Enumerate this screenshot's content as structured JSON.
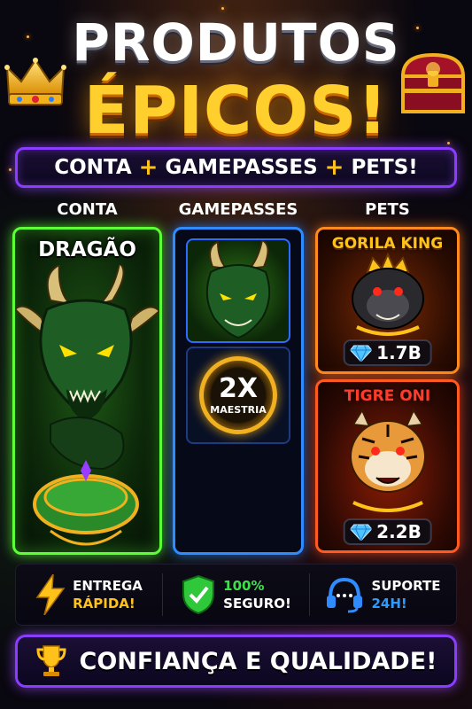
{
  "header": {
    "title_line1": "PRODUTOS",
    "title_line2": "ÉPICOS!"
  },
  "banner": {
    "item1": "CONTA",
    "plus1": "+",
    "item2": "GAMEPASSES",
    "plus2": "+",
    "item3": "PETS!"
  },
  "columns": {
    "conta_label": "CONTA",
    "gamepasses_label": "GAMEPASSES",
    "pets_label": "PETS"
  },
  "conta_panel": {
    "label": "DRAGÃO"
  },
  "gamepasses_panel": {
    "multiplier": "2X",
    "multiplier_text": "MAESTRIA"
  },
  "pets": [
    {
      "name": "GORILA KING",
      "price": "1.7B"
    },
    {
      "name": "TIGRE ONI",
      "price": "2.2B"
    }
  ],
  "features": [
    {
      "line1": "ENTREGA",
      "line2": "RÁPIDA!",
      "icon": "lightning-icon",
      "accent": "#ffc21a"
    },
    {
      "line1": "100%",
      "line2": "SEGURO!",
      "icon": "shield-check-icon",
      "accent": "#3ee04a"
    },
    {
      "line1": "SUPORTE",
      "line2": "24H!",
      "icon": "headset-icon",
      "accent": "#2e8cff"
    }
  ],
  "footer": {
    "text": "CONFIANÇA E QUALIDADE!"
  },
  "colors": {
    "gold": "#ffc21a",
    "purple_border": "#8b3dff",
    "green_border": "#5dff37",
    "blue_border": "#2e8cff",
    "orange_border": "#ff8a1f"
  }
}
